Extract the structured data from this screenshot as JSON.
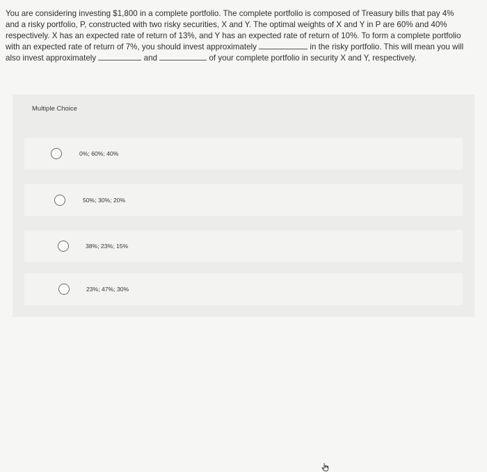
{
  "question": {
    "lines": [
      "You are considering investing $1,800 in a complete portfolio. The complete portfolio is composed of Treasury bills that pay 4%",
      "and a risky portfolio, P, constructed with two risky securities, X and Y. The optimal weights of X and Y in P are 60% and 40%",
      "respectively. X has an expected rate of return of 13%, and Y has an expected rate of return of 10%. To form a complete portfolio"
    ],
    "line4_a": "with an expected rate of return of 7%, you should invest approximately",
    "line4_b": "in the risky portfolio. This will mean you will",
    "line5_a": "also invest approximately",
    "line5_b": "and",
    "line5_c": "of your complete portfolio in security X and Y, respectively."
  },
  "multiple_choice": {
    "label": "Multiple Choice",
    "options": [
      {
        "label": "0%; 60%; 40%"
      },
      {
        "label": "50%; 30%; 20%"
      },
      {
        "label": "38%; 23%; 15%"
      },
      {
        "label": "23%; 47%; 30%"
      }
    ]
  },
  "icons": {
    "cursor": "hand-pointer-icon"
  }
}
